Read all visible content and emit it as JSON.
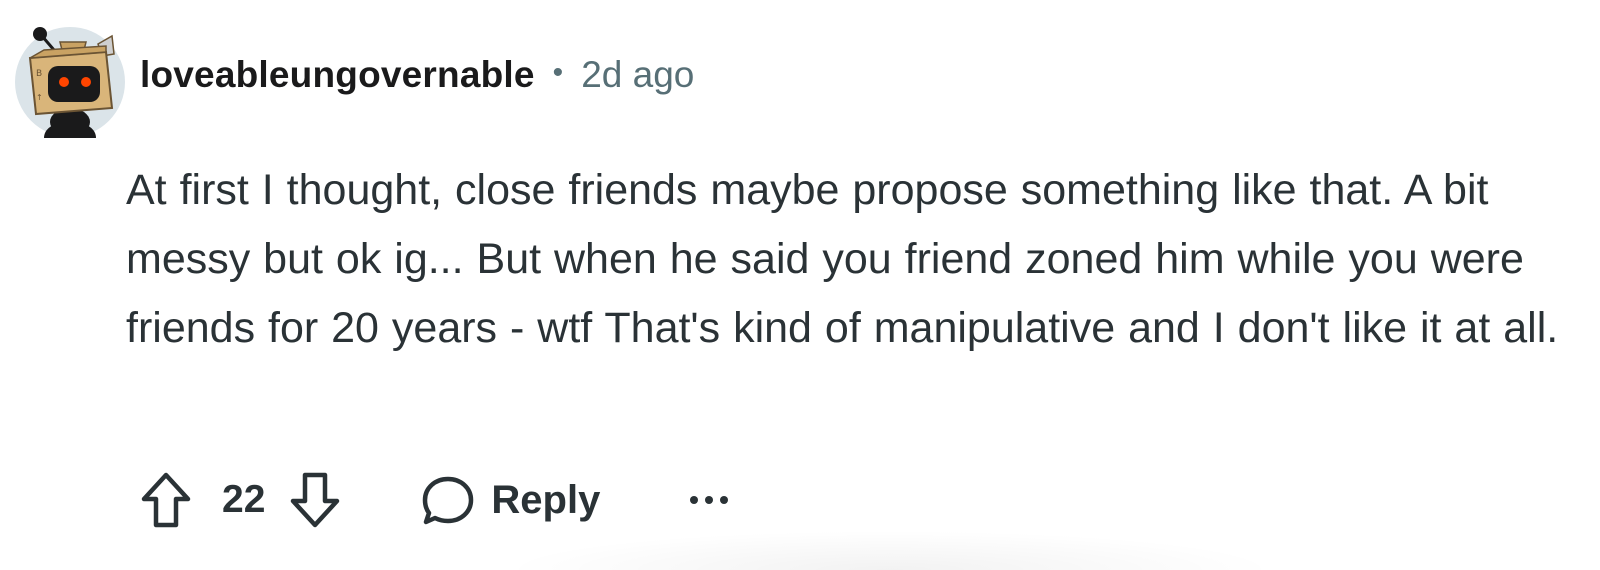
{
  "comment": {
    "author": "loveableungovernable",
    "separator": "•",
    "timestamp": "2d ago",
    "body": "At first I thought, close friends maybe propose something like that. A bit messy but ok ig... But when he said you friend zoned him while you were friends for 20 years - wtf That's kind of manipulative and I don't like it at all.",
    "avatar_icon": "snoo-cardboard-box-avatar-icon"
  },
  "actions": {
    "upvote_icon": "arrow-up-icon",
    "score": "22",
    "downvote_icon": "arrow-down-icon",
    "reply_icon": "speech-bubble-icon",
    "reply_label": "Reply",
    "more_icon": "ellipsis-icon"
  },
  "colors": {
    "text": "#2a3236",
    "meta": "#576f76",
    "avatar_bg": "#dbe4e9",
    "box_tan": "#d9b57a",
    "eye_red": "#ff4500"
  }
}
